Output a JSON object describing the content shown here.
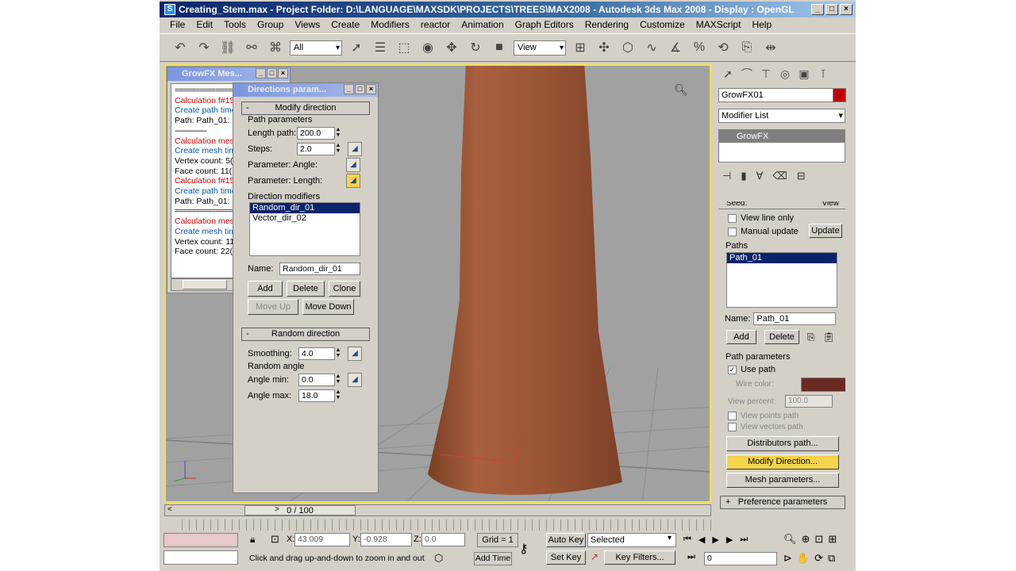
{
  "window": {
    "title": "Creating_Stem.max     - Project Folder: D:\\LANGUAGE\\MAXSDK\\PROJECTS\\TREES\\MAX2008     - Autodesk 3ds Max 2008     - Display : OpenGL",
    "app_icon": "3ds-max-icon",
    "btn_min": "_",
    "btn_max": "□",
    "btn_close": "×"
  },
  "menu": [
    "File",
    "Edit",
    "Tools",
    "Group",
    "Views",
    "Create",
    "Modifiers",
    "reactor",
    "Animation",
    "Graph Editors",
    "Rendering",
    "Customize",
    "MAXScript",
    "Help"
  ],
  "toolbar": {
    "selection_filter": "All",
    "coord_system": "View"
  },
  "growfx_log": {
    "title": "GrowFX Mes...",
    "lines": [
      {
        "text": "================",
        "type": "sep"
      },
      {
        "text": "Calculation f#15",
        "type": "red"
      },
      {
        "text": "Create path time",
        "type": "blue"
      },
      {
        "text": "Path: Path_01:",
        "type": "plain"
      },
      {
        "text": "----------------",
        "type": "sep"
      },
      {
        "text": "Calculation mes",
        "type": "red"
      },
      {
        "text": "Create mesh tim",
        "type": "blue"
      },
      {
        "text": "Vertex count: 5(",
        "type": "plain"
      },
      {
        "text": "Face count: 11(",
        "type": "plain"
      },
      {
        "text": "Calculation f#15",
        "type": "red"
      },
      {
        "text": "Create path time",
        "type": "blue"
      },
      {
        "text": "Path: Path_01:",
        "type": "plain"
      },
      {
        "text": "================",
        "type": "sep"
      },
      {
        "text": "Calculation mes",
        "type": "red"
      },
      {
        "text": "Create mesh tim",
        "type": "blue"
      },
      {
        "text": "Vertex count: 11",
        "type": "plain"
      },
      {
        "text": "Face count: 22(",
        "type": "plain"
      }
    ]
  },
  "directions_dialog": {
    "title": "Directions param...",
    "modify_direction": {
      "header": "Modify direction",
      "path_parameters_label": "Path parameters",
      "length_path_label": "Length path:",
      "length_path_value": "200.0",
      "steps_label": "Steps:",
      "steps_value": "2.0",
      "param_angle_label": "Parameter: Angle:",
      "param_length_label": "Parameter: Length:",
      "direction_modifiers_label": "Direction modifiers",
      "modifiers": [
        "Random_dir_01",
        "Vector_dir_02"
      ],
      "selected_modifier": "Random_dir_01",
      "name_label": "Name:",
      "name_value": "Random_dir_01",
      "add": "Add",
      "delete": "Delete",
      "clone": "Clone",
      "move_up": "Move Up",
      "move_down": "Move Down"
    },
    "random_direction": {
      "header": "Random direction",
      "smoothing_label": "Smoothing:",
      "smoothing_value": "4.0",
      "random_angle_label": "Random angle",
      "angle_min_label": "Angle min:",
      "angle_min_value": "0.0",
      "angle_max_label": "Angle max:",
      "angle_max_value": "18.0"
    }
  },
  "command_panel": {
    "object_name": "GrowFX01",
    "object_color": "#c00000",
    "modifier_list": "Modifier List",
    "stack_item": "GrowFX",
    "seed_label": "Seed:",
    "view_btn": "View",
    "view_line_only": "View line only",
    "manual_update": "Manual update",
    "update_btn": "Update",
    "paths_label": "Paths",
    "paths": [
      "Path_01"
    ],
    "name_label": "Name:",
    "name_value": "Path_01",
    "add": "Add",
    "delete": "Delete",
    "path_parameters_label": "Path parameters",
    "use_path": "Use path",
    "wire_color_label": "Wire color:",
    "wire_color": "#6b2a22",
    "view_percent_label": "View percent:",
    "view_percent_value": "100.0",
    "view_points_path": "View points path",
    "view_vectors_path": "View vectors path",
    "distributors_btn": "Distributors path...",
    "modify_direction_btn": "Modify Direction...",
    "mesh_parameters_btn": "Mesh parameters...",
    "preference_parameters": "Preference parameters"
  },
  "timeline": {
    "frame": "0 / 100"
  },
  "status": {
    "x_label": "X:",
    "x_value": "43.009",
    "y_label": "Y:",
    "y_value": "-0.928",
    "z_label": "Z:",
    "z_value": "0.0",
    "grid": "Grid = 1",
    "auto_key": "Auto Key",
    "set_key": "Set Key",
    "selected": "Selected",
    "key_filters": "Key Filters...",
    "prompt": "Click and drag up-and-down to zoom in and out",
    "add_time_tag": "Add Time",
    "frame_value": "0"
  },
  "colors": {
    "accent": "#f0e34c",
    "trunk": "#a0583a",
    "selection": "#0a246a"
  }
}
